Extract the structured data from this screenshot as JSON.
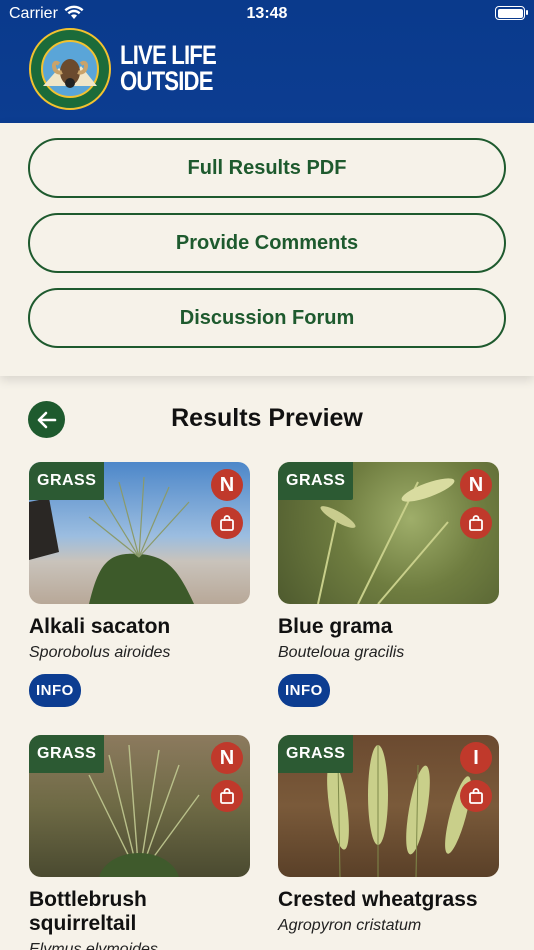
{
  "status_bar": {
    "carrier": "Carrier",
    "time": "13:48"
  },
  "header": {
    "logo_text": "COLORADO PARKS & WILDLIFE",
    "brand_line1": "LIVE LIFE",
    "brand_line2": "OUTSIDE"
  },
  "actions": [
    {
      "label": "Full Results PDF"
    },
    {
      "label": "Provide Comments"
    },
    {
      "label": "Discussion Forum"
    }
  ],
  "results": {
    "title": "Results Preview",
    "info_label": "INFO",
    "cards": [
      {
        "tag": "GRASS",
        "badge": "N",
        "name": "Alkali sacaton",
        "scientific": "Sporobolus airoides",
        "icon": "shopping-bag-icon"
      },
      {
        "tag": "GRASS",
        "badge": "N",
        "name": "Blue grama",
        "scientific": "Bouteloua gracilis",
        "icon": "shopping-bag-icon"
      },
      {
        "tag": "GRASS",
        "badge": "N",
        "name": "Bottlebrush squirreltail",
        "scientific": "Elymus elymoides",
        "icon": "shopping-bag-icon"
      },
      {
        "tag": "GRASS",
        "badge": "I",
        "name": "Crested wheatgrass",
        "scientific": "Agropyron cristatum",
        "icon": "shopping-bag-icon"
      }
    ]
  },
  "colors": {
    "header_blue": "#0c3d91",
    "forest_green": "#1e5a2e",
    "badge_red": "#c0392b",
    "background": "#f6f2e9"
  }
}
